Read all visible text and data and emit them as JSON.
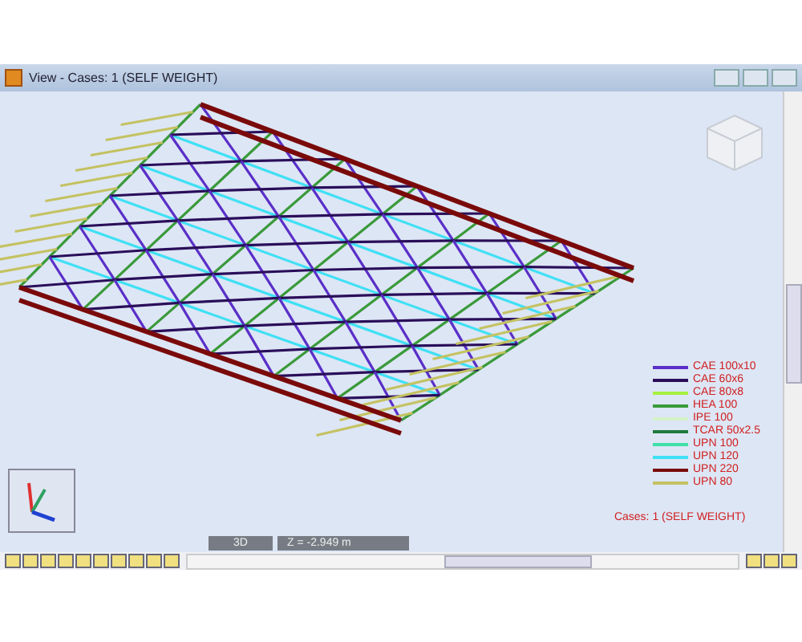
{
  "window": {
    "title": "View - Cases: 1 (SELF WEIGHT)"
  },
  "legend": [
    {
      "label": "CAE 100x10",
      "color": "#5a2fc8"
    },
    {
      "label": "CAE 60x6",
      "color": "#2a0e5a"
    },
    {
      "label": "CAE 80x8",
      "color": "#a6f040"
    },
    {
      "label": "HEA 100",
      "color": "#3a9a3a"
    },
    {
      "label": "IPE 100",
      "color": "#d4f2c8"
    },
    {
      "label": "TCAR 50x2.5",
      "color": "#1f7a3c"
    },
    {
      "label": "UPN 100",
      "color": "#3ee0a8"
    },
    {
      "label": "UPN 120",
      "color": "#40e0f4"
    },
    {
      "label": "UPN 220",
      "color": "#7a0a0a"
    },
    {
      "label": "UPN 80",
      "color": "#c4c262"
    }
  ],
  "case_label": "Cases: 1 (SELF WEIGHT)",
  "status": {
    "mode": "3D",
    "z": "Z = -2.949 m"
  }
}
